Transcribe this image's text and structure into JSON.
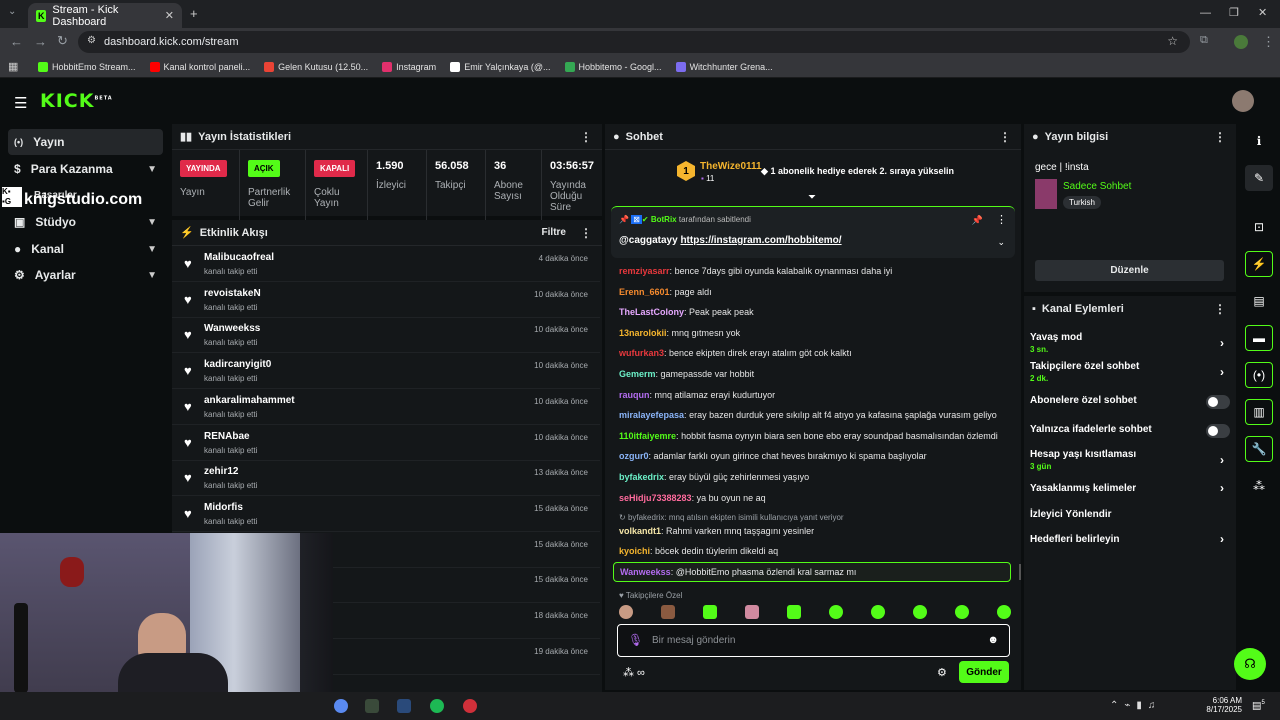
{
  "browser": {
    "tab_title": "Stream - Kick Dashboard",
    "url": "dashboard.kick.com/stream",
    "bookmarks": [
      {
        "label": "HobbitEmo Stream...",
        "color": "#53fc18"
      },
      {
        "label": "Kanal kontrol paneli...",
        "color": "#ff0000"
      },
      {
        "label": "Gelen Kutusu (12.50...",
        "color": "#ea4335"
      },
      {
        "label": "Instagram",
        "color": "#e1306c"
      },
      {
        "label": "Emir Yalçınkaya (@...",
        "color": "#ffffff"
      },
      {
        "label": "Hobbitemo - Googl...",
        "color": "#34a853"
      },
      {
        "label": "Witchhunter Grena...",
        "color": "#7c6cf0"
      }
    ]
  },
  "app": {
    "logo": "KICK",
    "logo_sup": "BETA"
  },
  "sidebar": {
    "items": [
      {
        "label": "Yayın",
        "icon": "broadcast-icon"
      },
      {
        "label": "Para Kazanma",
        "icon": "dollar-icon"
      },
      {
        "label": "Stüdyo",
        "icon": "studio-icon"
      },
      {
        "label": "Kanal",
        "icon": "user-icon"
      },
      {
        "label": "Ayarlar",
        "icon": "gear-icon"
      }
    ],
    "overlay_text_1": "Başarılar",
    "overlay_text_2": "knigstudio.com"
  },
  "stats": {
    "title": "Yayın İstatistikleri",
    "items": [
      {
        "badge": "YAYINDA",
        "label": "Yayın"
      },
      {
        "badge": "AÇIK",
        "label": "Partnerlik Gelir"
      },
      {
        "badge": "KAPALI",
        "label": "Çoklu Yayın"
      },
      {
        "value": "1.590",
        "label": "İzleyici"
      },
      {
        "value": "56.058",
        "label": "Takipçi"
      },
      {
        "value": "36",
        "label": "Abone Sayısı"
      },
      {
        "value": "03:56:57",
        "label": "Yayında Olduğu Süre"
      }
    ]
  },
  "activity": {
    "title": "Etkinlik Akışı",
    "filter": "Filtre",
    "items": [
      {
        "name": "Malibucaofreal",
        "sub": "kanalı takip etti",
        "time": "4 dakika önce"
      },
      {
        "name": "revoistakeN",
        "sub": "kanalı takip etti",
        "time": "10 dakika önce"
      },
      {
        "name": "Wanweekss",
        "sub": "kanalı takip etti",
        "time": "10 dakika önce"
      },
      {
        "name": "kadircanyigit0",
        "sub": "kanalı takip etti",
        "time": "10 dakika önce"
      },
      {
        "name": "ankaralimahammet",
        "sub": "kanalı takip etti",
        "time": "10 dakika önce"
      },
      {
        "name": "RENAbae",
        "sub": "kanalı takip etti",
        "time": "10 dakika önce"
      },
      {
        "name": "zehir12",
        "sub": "kanalı takip etti",
        "time": "13 dakika önce"
      },
      {
        "name": "Midorfis",
        "sub": "kanalı takip etti",
        "time": "15 dakika önce"
      },
      {
        "name": "",
        "sub": "",
        "time": "15 dakika önce"
      },
      {
        "name": "",
        "sub": "",
        "time": "15 dakika önce"
      },
      {
        "name": "",
        "sub": "",
        "time": "18 dakika önce"
      },
      {
        "name": "",
        "sub": "",
        "time": "19 dakika önce"
      }
    ]
  },
  "chat": {
    "title": "Sohbet",
    "gift_user": "TheWize0111",
    "gift_count": "11",
    "gift_text": "1 abonelik hediye ederek 2. sıraya yükselin",
    "pinned_by": "BotRix",
    "pinned_suffix": "tarafından sabitlendi",
    "pinned_user": "@caggatayy",
    "pinned_link": "https://instagram.com/hobbitemo/",
    "messages": [
      {
        "user": "remziyasarr",
        "color": "#e8383d",
        "text": "bence 7days gibi oyunda kalabalık oynanması daha iyi"
      },
      {
        "user": "Erenn_6601",
        "color": "#f58a2e",
        "text": "page aldı"
      },
      {
        "user": "TheLastColony",
        "color": "#e6a8ff",
        "text": "Peak peak peak"
      },
      {
        "user": "13narolokii",
        "color": "#f5b52e",
        "text": "mnq gıtmesn yok"
      },
      {
        "user": "wufurkan3",
        "color": "#e8383d",
        "text": "bence ekipten direk erayı atalım göt cok kalktı"
      },
      {
        "user": "Gemerm",
        "color": "#6cf0c8",
        "text": "gamepassde var hobbit"
      },
      {
        "user": "rauqun",
        "color": "#b36cf0",
        "text": "mnq atilamaz erayi kudurtuyor"
      },
      {
        "user": "miralayefepasa",
        "color": "#8ab4f8",
        "text": "eray bazen durduk yere sıkılıp alt f4 atıyo ya kafasına şaplağa vurasım geliyo"
      },
      {
        "user": "110itfaiyemre",
        "color": "#53fc18",
        "text": "hobbit fasma oynyın biara sen bone ebo eray soundpad basmalısından özlemdi"
      },
      {
        "user": "ozgur0",
        "color": "#8ab4f8",
        "text": "adamlar farklı oyun girince chat heves bırakmıyo ki spama başlıyolar"
      },
      {
        "user": "byfakedrix",
        "color": "#6cf0c8",
        "text": "eray büyül güç zehirlenmesi yaşıyo"
      },
      {
        "user": "seHidju73388283",
        "color": "#ff6b9d",
        "text": "ya bu oyun ne aq"
      }
    ],
    "reply_hint": "byfakedrix: mnq atılsın ekipten isimili kullanıcıya yanıt veriyor",
    "messages2": [
      {
        "user": "volkandt1",
        "color": "#f5e6a8",
        "text": "Rahmi varken mnq taşşagını yesinler"
      },
      {
        "user": "kyoichi",
        "color": "#f5b52e",
        "text": "böcek dedin tüylerim dikeldi aq"
      }
    ],
    "highlight": {
      "user": "Wanweekss",
      "color": "#b36cf0",
      "text": "@HobbitEmo phasma özlendi kral sarmaz mı"
    },
    "followers_only": "Takipçilere Özel",
    "input_placeholder": "Bir mesaj gönderin",
    "send": "Gönder"
  },
  "stream_info": {
    "title": "Yayın bilgisi",
    "stream_title": "gece | !insta",
    "category": "Sadece Sohbet",
    "language": "Turkish",
    "edit": "Düzenle"
  },
  "channel_actions": {
    "title": "Kanal Eylemleri",
    "items": [
      {
        "label": "Yavaş mod",
        "sub": "3 sn.",
        "kind": "arrow"
      },
      {
        "label": "Takipçilere özel sohbet",
        "sub": "2 dk.",
        "kind": "arrow"
      },
      {
        "label": "Abonelere özel sohbet",
        "sub": "",
        "kind": "toggle"
      },
      {
        "label": "Yalnızca ifadelerle sohbet",
        "sub": "",
        "kind": "toggle"
      },
      {
        "label": "Hesap yaşı kısıtlaması",
        "sub": "3 gün",
        "kind": "arrow"
      },
      {
        "label": "Yasaklanmış kelimeler",
        "sub": "",
        "kind": "arrow"
      },
      {
        "label": "İzleyici Yönlendir",
        "sub": "",
        "kind": "none"
      },
      {
        "label": "Hedefleri belirleyin",
        "sub": "",
        "kind": "arrow"
      }
    ]
  },
  "taskbar": {
    "time": "6:06 AM",
    "date": "8/17/2025",
    "notif": "5"
  }
}
